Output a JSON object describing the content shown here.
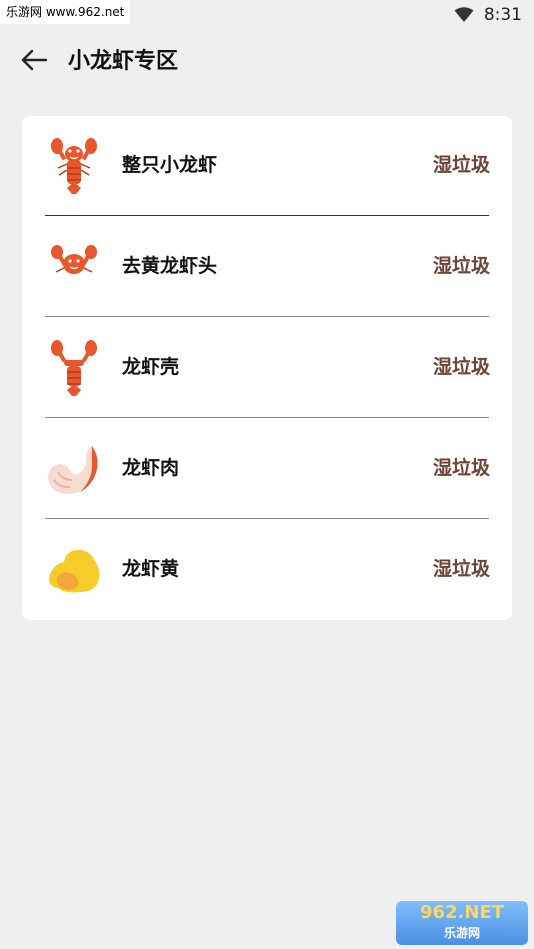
{
  "status_bar": {
    "watermark_text": "乐游网 www.962.net",
    "time": "8:31",
    "wifi_icon": "wifi-icon"
  },
  "header": {
    "back_icon": "back-arrow-icon",
    "title": "小龙虾专区"
  },
  "items": [
    {
      "name": "整只小龙虾",
      "category": "湿垃圾",
      "icon": "whole-crayfish-icon"
    },
    {
      "name": "去黄龙虾头",
      "category": "湿垃圾",
      "icon": "crayfish-head-icon"
    },
    {
      "name": "龙虾壳",
      "category": "湿垃圾",
      "icon": "crayfish-shell-icon"
    },
    {
      "name": "龙虾肉",
      "category": "湿垃圾",
      "icon": "crayfish-meat-icon"
    },
    {
      "name": "龙虾黄",
      "category": "湿垃圾",
      "icon": "crayfish-roe-icon"
    }
  ],
  "watermark_bottom": {
    "big": "962.NET",
    "small": "乐游网"
  },
  "colors": {
    "background": "#efefef",
    "card": "#ffffff",
    "category_text": "#6e4535",
    "crayfish": "#e8562b",
    "roe": "#f5c518"
  }
}
